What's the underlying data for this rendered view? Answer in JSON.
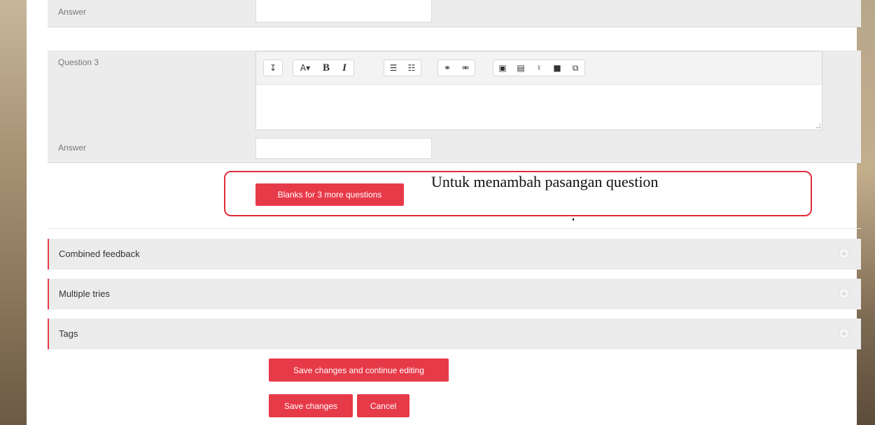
{
  "form": {
    "answer_label_top": "Answer",
    "question3_label": "Question 3",
    "answer_label": "Answer",
    "toolbar": {
      "groups": [
        {
          "buttons": [
            {
              "icon": "collapse-icon",
              "glyph": "↧"
            }
          ]
        },
        {
          "buttons": [
            {
              "icon": "font-style-icon",
              "glyph": "A▾"
            },
            {
              "icon": "bold-icon",
              "glyph": "B"
            },
            {
              "icon": "italic-icon",
              "glyph": "I"
            }
          ]
        },
        {
          "buttons": [
            {
              "icon": "bullet-list-icon",
              "glyph": "☰"
            },
            {
              "icon": "numbered-list-icon",
              "glyph": "☷"
            }
          ]
        },
        {
          "buttons": [
            {
              "icon": "link-icon",
              "glyph": "⚭"
            },
            {
              "icon": "unlink-icon",
              "glyph": "⚮"
            }
          ]
        },
        {
          "buttons": [
            {
              "icon": "image-icon",
              "glyph": "▣"
            },
            {
              "icon": "media-icon",
              "glyph": "▤"
            },
            {
              "icon": "record-audio-icon",
              "glyph": "♮"
            },
            {
              "icon": "record-video-icon",
              "glyph": "■"
            },
            {
              "icon": "manage-files-icon",
              "glyph": "⧉"
            }
          ]
        }
      ]
    },
    "blanks_button": "Blanks for 3 more questions"
  },
  "annotation": {
    "text": "Untuk menambah pasangan question",
    "color": "#e12d3b"
  },
  "sections": [
    {
      "title": "Combined feedback"
    },
    {
      "title": "Multiple tries"
    },
    {
      "title": "Tags"
    }
  ],
  "actions": {
    "save_continue": "Save changes and continue editing",
    "save": "Save changes",
    "cancel": "Cancel"
  },
  "colors": {
    "accent": "#e73a49",
    "panel": "#ececec"
  }
}
